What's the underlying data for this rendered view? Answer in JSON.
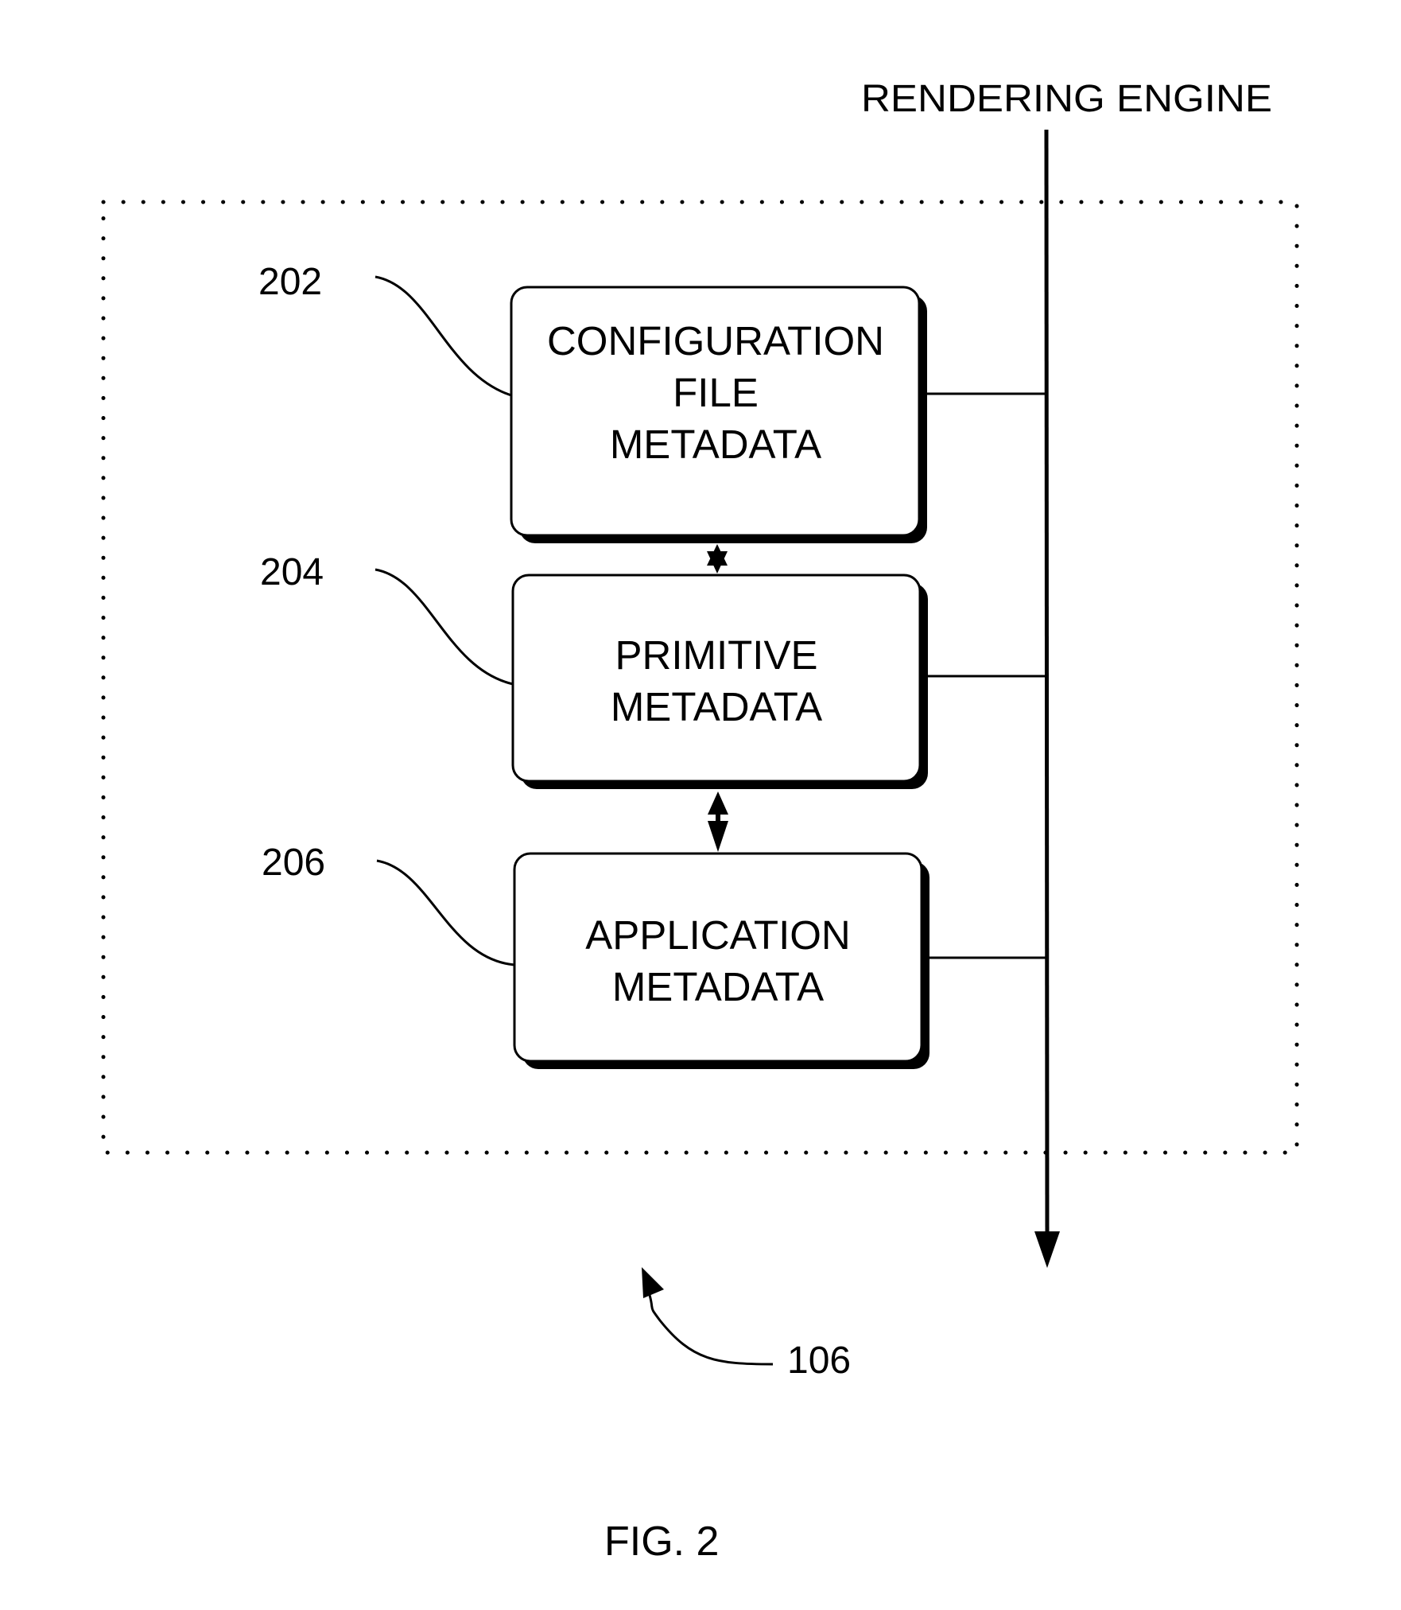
{
  "figure": {
    "caption": "FIG. 2",
    "reference_numeral": "106",
    "output_label": "RENDERING ENGINE"
  },
  "blocks": [
    {
      "ref": "202",
      "lines": [
        "CONFIGURATION",
        "FILE",
        "METADATA"
      ]
    },
    {
      "ref": "204",
      "lines": [
        "PRIMITIVE",
        "METADATA"
      ]
    },
    {
      "ref": "206",
      "lines": [
        "APPLICATION",
        "METADATA"
      ]
    }
  ],
  "connections": [
    {
      "from": "202",
      "to": "204",
      "type": "bidirectional"
    },
    {
      "from": "204",
      "to": "206",
      "type": "bidirectional"
    },
    {
      "from": "202",
      "to": "RENDERING ENGINE",
      "type": "line"
    },
    {
      "from": "204",
      "to": "RENDERING ENGINE",
      "type": "line"
    },
    {
      "from": "206",
      "to": "RENDERING ENGINE",
      "type": "line"
    }
  ]
}
